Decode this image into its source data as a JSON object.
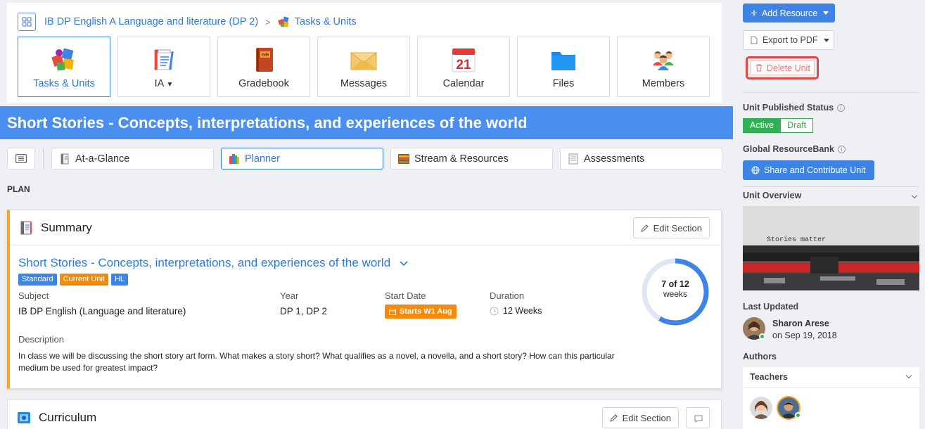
{
  "breadcrumb": {
    "course": "IB DP English A Language and literature (DP 2)",
    "separator": ">",
    "current": "Tasks & Units"
  },
  "tools": [
    {
      "label": "Tasks & Units",
      "icon": "puzzle-icon",
      "active": true
    },
    {
      "label": "IA",
      "icon": "ia-notebook-icon",
      "dropdown": true
    },
    {
      "label": "Gradebook",
      "icon": "gradebook-icon"
    },
    {
      "label": "Messages",
      "icon": "envelope-icon"
    },
    {
      "label": "Calendar",
      "icon": "calendar-icon",
      "day": "21"
    },
    {
      "label": "Files",
      "icon": "folder-icon"
    },
    {
      "label": "Members",
      "icon": "members-icon"
    }
  ],
  "unit_title": "Short Stories - Concepts, interpretations, and experiences of the world",
  "tabs": [
    {
      "label": "At-a-Glance"
    },
    {
      "label": "Planner",
      "active": true
    },
    {
      "label": "Stream & Resources"
    },
    {
      "label": "Assessments"
    }
  ],
  "plan_label": "PLAN",
  "summary": {
    "title": "Summary",
    "edit_label": "Edit Section",
    "unit_link": "Short Stories - Concepts, interpretations, and experiences of the world",
    "badges": [
      {
        "label": "Standard",
        "color": "#3d84e6"
      },
      {
        "label": "Current Unit",
        "color": "#f58a0a"
      },
      {
        "label": "HL",
        "color": "#3d84e6"
      }
    ],
    "subject_label": "Subject",
    "subject_value": "IB DP English (Language and literature)",
    "year_label": "Year",
    "year_value": "DP 1, DP 2",
    "start_label": "Start Date",
    "start_value": "Starts W1 Aug",
    "duration_label": "Duration",
    "duration_value": "12 Weeks",
    "progress_main": "7 of 12",
    "progress_unit": "weeks",
    "progress_fraction": 0.583,
    "description_label": "Description",
    "description": "In class we will be discussing the short story art form. What makes a story short? What qualifies as a novel, a novella, and a short story? How can this particular medium be used for greatest impact?"
  },
  "curriculum": {
    "title": "Curriculum",
    "edit_label": "Edit Section"
  },
  "sidebar": {
    "add_resource": "Add Resource",
    "export_pdf": "Export to PDF",
    "delete_unit": "Delete Unit",
    "published_label": "Unit Published Status",
    "status_active": "Active",
    "status_draft": "Draft",
    "resourcebank_label": "Global ResourceBank",
    "share_label": "Share and Contribute Unit",
    "overview_label": "Unit Overview",
    "overview_image_text": "Stories matter",
    "last_updated_label": "Last Updated",
    "updated_by": "Sharon Arese",
    "updated_on": "on Sep 19, 2018",
    "authors_label": "Authors",
    "teachers_label": "Teachers"
  },
  "colors": {
    "banner": "#4a8ff0",
    "primary": "#3d84e6",
    "accent_orange": "#f58a0a",
    "success": "#2fb052",
    "danger": "#e04848"
  }
}
